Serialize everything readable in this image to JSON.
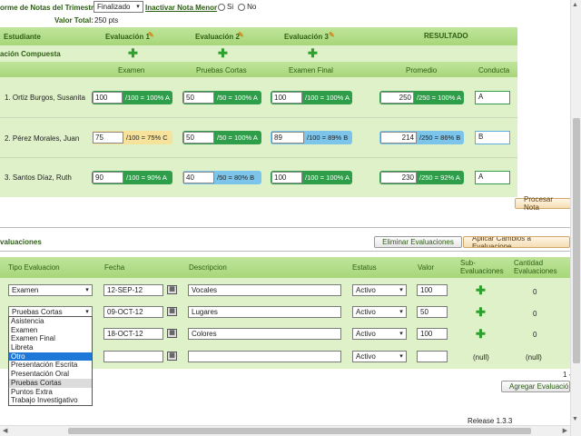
{
  "header": {
    "title": "orme de Notas del Trimestre",
    "status_select": "Finalizado",
    "inactivar_label": "Inactivar Nota Menor",
    "radio_si": "Si",
    "radio_no": "No",
    "valor_total_label": "Valor Total:",
    "valor_total_value": "250 pts"
  },
  "grades_table": {
    "col_estudiante": "Estudiante",
    "eval1": "Evaluación 1",
    "eval2": "Evaluación 2",
    "eval3": "Evaluación 3",
    "resultado": "RESULTADO",
    "compuesta": "ación Compuesta",
    "sub_examen": "Examen",
    "sub_pruebas": "Pruebas Cortas",
    "sub_final": "Examen Final",
    "sub_promedio": "Promedio",
    "sub_conducta": "Conducta",
    "rows": [
      {
        "name": "1. Ortiz Burgos, Susanita",
        "e1": "100",
        "e1l": "/100 = 100% A",
        "e2": "50",
        "e2l": "/50 = 100% A",
        "e3": "100",
        "e3l": "/100 = 100% A",
        "prom": "250",
        "proml": "/250 = 100% A",
        "cond": "A"
      },
      {
        "name": "2. Pérez Morales, Juan",
        "e1": "75",
        "e1l": "/100 = 75% C",
        "e2": "50",
        "e2l": "/50 = 100% A",
        "e3": "89",
        "e3l": "/100 = 89% B",
        "prom": "214",
        "proml": "/250 = 86% B",
        "cond": "B"
      },
      {
        "name": "3. Santos Díaz, Ruth",
        "e1": "90",
        "e1l": "/100 = 90% A",
        "e2": "40",
        "e2l": "/50 = 80% B",
        "e3": "100",
        "e3l": "/100 = 100% A",
        "prom": "230",
        "proml": "/250 = 92% A",
        "cond": "A"
      }
    ],
    "procesar_button": "Procesar Nota"
  },
  "evaluaciones": {
    "section_title": "valuaciones",
    "eliminar_button": "Eliminar Evaluaciones",
    "aplicar_button": "Aplicar Cambios a Evaluacione",
    "col_tipo": "Tipo Evaluacion",
    "col_fecha": "Fecha",
    "col_desc": "Descripcion",
    "col_estatus": "Estatus",
    "col_valor": "Valor",
    "col_sub1": "Sub-",
    "col_sub2": "Evaluaciones",
    "col_cant1": "Cantidad",
    "col_cant2": "Evaluaciones",
    "rows": [
      {
        "tipo": "Examen",
        "fecha": "12-SEP-12",
        "desc": "Vocales",
        "estatus": "Activo",
        "valor": "100",
        "cant": "0"
      },
      {
        "tipo": "Pruebas Cortas",
        "fecha": "09-OCT-12",
        "desc": "Lugares",
        "estatus": "Activo",
        "valor": "50",
        "cant": "0"
      },
      {
        "tipo": "",
        "fecha": "18-OCT-12",
        "desc": "Colores",
        "estatus": "Activo",
        "valor": "100",
        "cant": "0"
      },
      {
        "tipo": "",
        "fecha": "",
        "desc": "",
        "estatus": "Activo",
        "valor": "",
        "cant": "(null)",
        "sub": "(null)"
      }
    ],
    "dropdown_options": [
      "Asistencia",
      "Examen",
      "Examen Final",
      "Libreta",
      "Otro",
      "Presentación Escrita",
      "Presentación Oral",
      "Pruebas Cortas",
      "Puntos Extra",
      "Trabajo Investigativo"
    ],
    "agregar_button": "Agregar Evaluació",
    "pager": "1 -"
  },
  "footer": {
    "release": "Release 1.3.3"
  }
}
